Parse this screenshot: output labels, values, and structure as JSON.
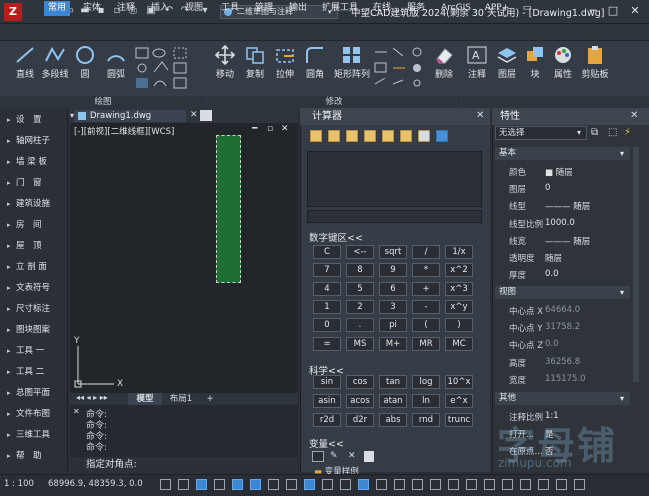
{
  "titlebar": {
    "workspace": "二维草图与注释",
    "app_title": "中望CAD建筑版 2024(剩余 30 天试用) - [Drawing1.dwg]",
    "logo": "Z"
  },
  "menus": [
    "常用",
    "实体",
    "注释",
    "插入",
    "视图",
    "工具",
    "管理",
    "输出",
    "扩展工具",
    "在线",
    "服务",
    "ArcGIS",
    "APP+"
  ],
  "ribbon": {
    "draw_tools": [
      "直线",
      "多段线",
      "圆",
      "圆弧"
    ],
    "draw_panel": "绘图",
    "modify_tools": [
      "移动",
      "复制",
      "拉伸",
      "圆角",
      "矩形阵列",
      "删除"
    ],
    "modify_panel": "修改",
    "right_tools": [
      "注释",
      "图层",
      "块",
      "属性",
      "剪贴板"
    ]
  },
  "leftnav": [
    "设　置",
    "轴网柱子",
    "墙 梁 板",
    "门　窗",
    "建筑设施",
    "房　间",
    "屋　顶",
    "立 剖 面",
    "文表符号",
    "尺寸标注",
    "图块图案",
    "工具 一",
    "工具 二",
    "总图平面",
    "文件布图",
    "三维工具",
    "帮　助"
  ],
  "drawing": {
    "tab": "Drawing1.dwg",
    "view_label": "[-][前视][二维线框][WCS]",
    "axis_y": "Y",
    "axis_x": "X"
  },
  "layout_tabs": [
    "模型",
    "布局1",
    "+"
  ],
  "command": {
    "history": [
      "命令:",
      "命令:",
      "命令:",
      "命令:"
    ],
    "prompt": "指定对角点:"
  },
  "calc": {
    "title": "计算器",
    "numpad_label": "数字键区<<",
    "numpad_keys": [
      "C",
      "<--",
      "sqrt",
      "/",
      "1/x",
      "7",
      "8",
      "9",
      "*",
      "x^2",
      "4",
      "5",
      "6",
      "+",
      "x^3",
      "1",
      "2",
      "3",
      "-",
      "x^y",
      "0",
      ".",
      "pi",
      "(",
      ")",
      "=",
      "MS",
      "M+",
      "MR",
      "MC"
    ],
    "sci_label": "科学<<",
    "sci_keys": [
      "sin",
      "cos",
      "tan",
      "log",
      "10^x",
      "asin",
      "acos",
      "atan",
      "ln",
      "e^x",
      "r2d",
      "d2r",
      "abs",
      "rnd",
      "trunc"
    ],
    "var_label": "变量<<",
    "var_item": "变量样例"
  },
  "props": {
    "title": "特性",
    "selection": "无选择",
    "groups": {
      "basic": "基本",
      "view": "视图",
      "misc": "其他"
    },
    "basic": [
      [
        "颜色",
        "■ 随层"
      ],
      [
        "图层",
        "0"
      ],
      [
        "线型",
        "——— 随层"
      ],
      [
        "线型比例",
        "1000.0"
      ],
      [
        "线宽",
        "——— 随层"
      ],
      [
        "透明度",
        "随层"
      ],
      [
        "厚度",
        "0.0"
      ]
    ],
    "view": [
      [
        "中心点 X",
        "64664.0"
      ],
      [
        "中心点 Y",
        "31758.2"
      ],
      [
        "中心点 Z",
        "0.0"
      ],
      [
        "高度",
        "36256.8"
      ],
      [
        "宽度",
        "115175.0"
      ]
    ],
    "misc": [
      [
        "注释比例",
        "1:1"
      ],
      [
        "打开...",
        "是"
      ],
      [
        "在原点...",
        "否"
      ]
    ]
  },
  "status": {
    "scale": "1 : 100",
    "coords": "68996.9, 48359.3, 0.0"
  },
  "watermark": {
    "main": "字母铺",
    "sub": "zimupu.com"
  }
}
